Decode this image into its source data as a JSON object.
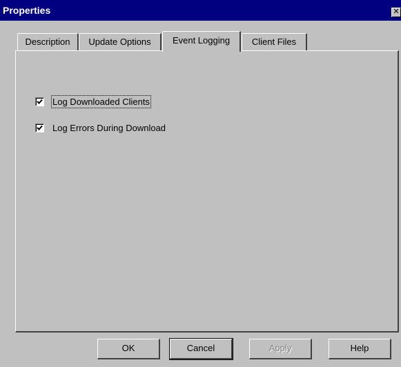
{
  "window": {
    "title": "Properties",
    "close_glyph": "✕"
  },
  "tabs": [
    {
      "label": "Description",
      "active": false
    },
    {
      "label": "Update Options",
      "active": false
    },
    {
      "label": "Event Logging",
      "active": true
    },
    {
      "label": "Client Files",
      "active": false
    }
  ],
  "event_logging": {
    "options": [
      {
        "label": "Log Downloaded Clients",
        "checked": true,
        "focused": true
      },
      {
        "label": "Log Errors During Download",
        "checked": true,
        "focused": false
      }
    ]
  },
  "buttons": {
    "ok": "OK",
    "cancel": "Cancel",
    "apply": "Apply",
    "help": "Help"
  },
  "colors": {
    "titlebar": "#000080",
    "face": "#c0c0c0",
    "disabled_text": "#808080"
  }
}
